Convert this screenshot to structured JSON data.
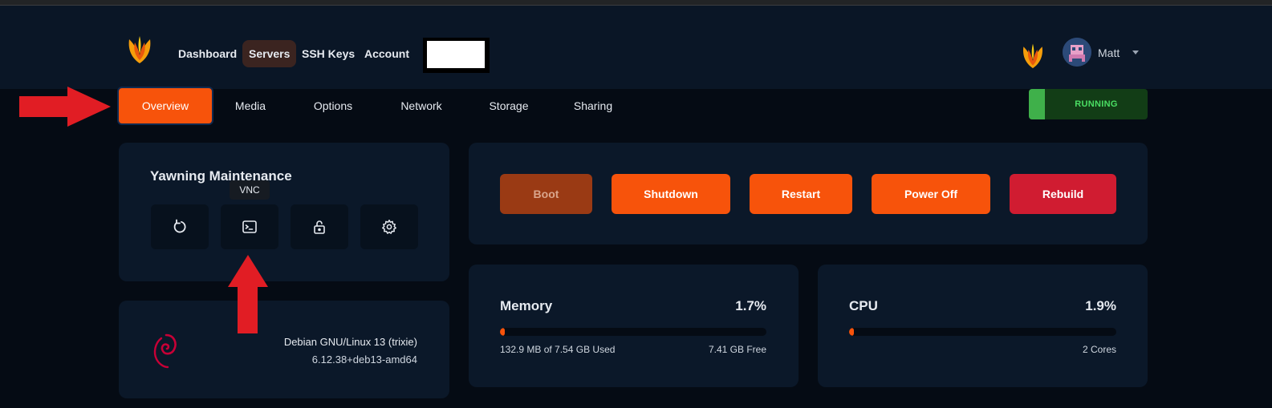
{
  "nav": {
    "items": [
      {
        "label": "Dashboard",
        "active": false
      },
      {
        "label": "Servers",
        "active": true
      },
      {
        "label": "SSH Keys",
        "active": false
      },
      {
        "label": "Account",
        "active": false
      }
    ],
    "user_name": "Matt"
  },
  "tabs": [
    {
      "label": "Overview",
      "active": true
    },
    {
      "label": "Media",
      "active": false
    },
    {
      "label": "Options",
      "active": false
    },
    {
      "label": "Network",
      "active": false
    },
    {
      "label": "Storage",
      "active": false
    },
    {
      "label": "Sharing",
      "active": false
    }
  ],
  "status": {
    "label": "RUNNING",
    "color": "#3fb04a"
  },
  "server": {
    "name": "Yawning Maintenance",
    "tooltip": "VNC",
    "icons": [
      "reinstall-icon",
      "terminal-icon",
      "unlock-icon",
      "gear-icon"
    ]
  },
  "os": {
    "name": "Debian GNU/Linux 13 (trixie)",
    "kernel": "6.12.38+deb13-amd64",
    "logo": "debian-swirl-icon"
  },
  "actions": [
    {
      "label": "Boot",
      "color": "#9a3a14",
      "disabled": true
    },
    {
      "label": "Shutdown",
      "color": "#f7530b",
      "disabled": false
    },
    {
      "label": "Restart",
      "color": "#f7530b",
      "disabled": false
    },
    {
      "label": "Power Off",
      "color": "#f7530b",
      "disabled": false
    },
    {
      "label": "Rebuild",
      "color": "#d01c31",
      "disabled": false
    }
  ],
  "memory": {
    "title": "Memory",
    "percent_label": "1.7%",
    "percent": 1.7,
    "used_label": "132.9 MB of 7.54 GB Used",
    "free_label": "7.41 GB Free"
  },
  "cpu": {
    "title": "CPU",
    "percent_label": "1.9%",
    "percent": 1.9,
    "cores_label": "2 Cores"
  },
  "accent_color": "#f7530b",
  "annotation_arrow_color": "#e11d24"
}
